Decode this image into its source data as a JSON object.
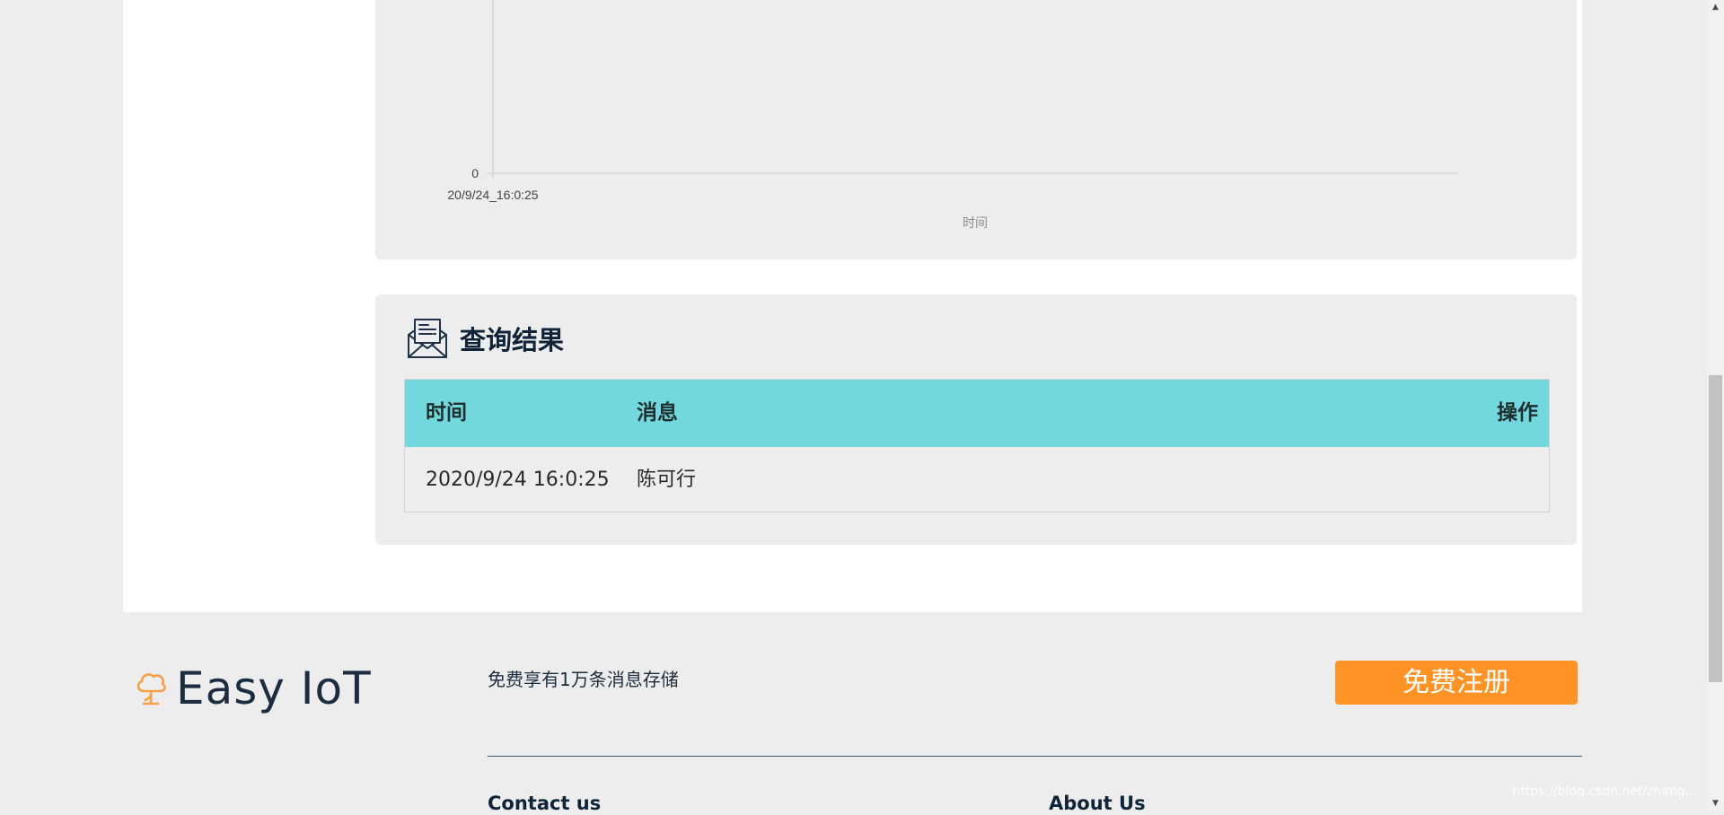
{
  "chart": {
    "xlabel": "时间",
    "y_tick": "0",
    "x_tick": "20/9/24_16:0:25"
  },
  "chart_data": {
    "type": "line",
    "x": [
      "20/9/24_16:0:25"
    ],
    "series": [
      {
        "values": [
          0
        ]
      }
    ],
    "xlabel": "时间",
    "ylabel": "",
    "y_ticks_visible": [
      "0"
    ],
    "grid": false
  },
  "results": {
    "title": "查询结果",
    "columns": {
      "time": "时间",
      "message": "消息",
      "action": "操作"
    },
    "rows": [
      {
        "time": "2020/9/24 16:0:25",
        "message": "陈可行",
        "action": ""
      }
    ]
  },
  "footer": {
    "logo_text": "Easy IoT",
    "promo": "免费享有1万条消息存储",
    "register_label": "免费注册",
    "contact_heading": "Contact us",
    "about_heading": "About Us",
    "watermark": "https://blog.csdn.net/zhang..."
  },
  "colors": {
    "table_header": "#72d8dd",
    "register_button": "#ff9326",
    "logo_icon": "#f7a047"
  },
  "icons": {
    "result_icon": "envelope-document-icon",
    "logo_icon": "cloud-tree-icon"
  }
}
